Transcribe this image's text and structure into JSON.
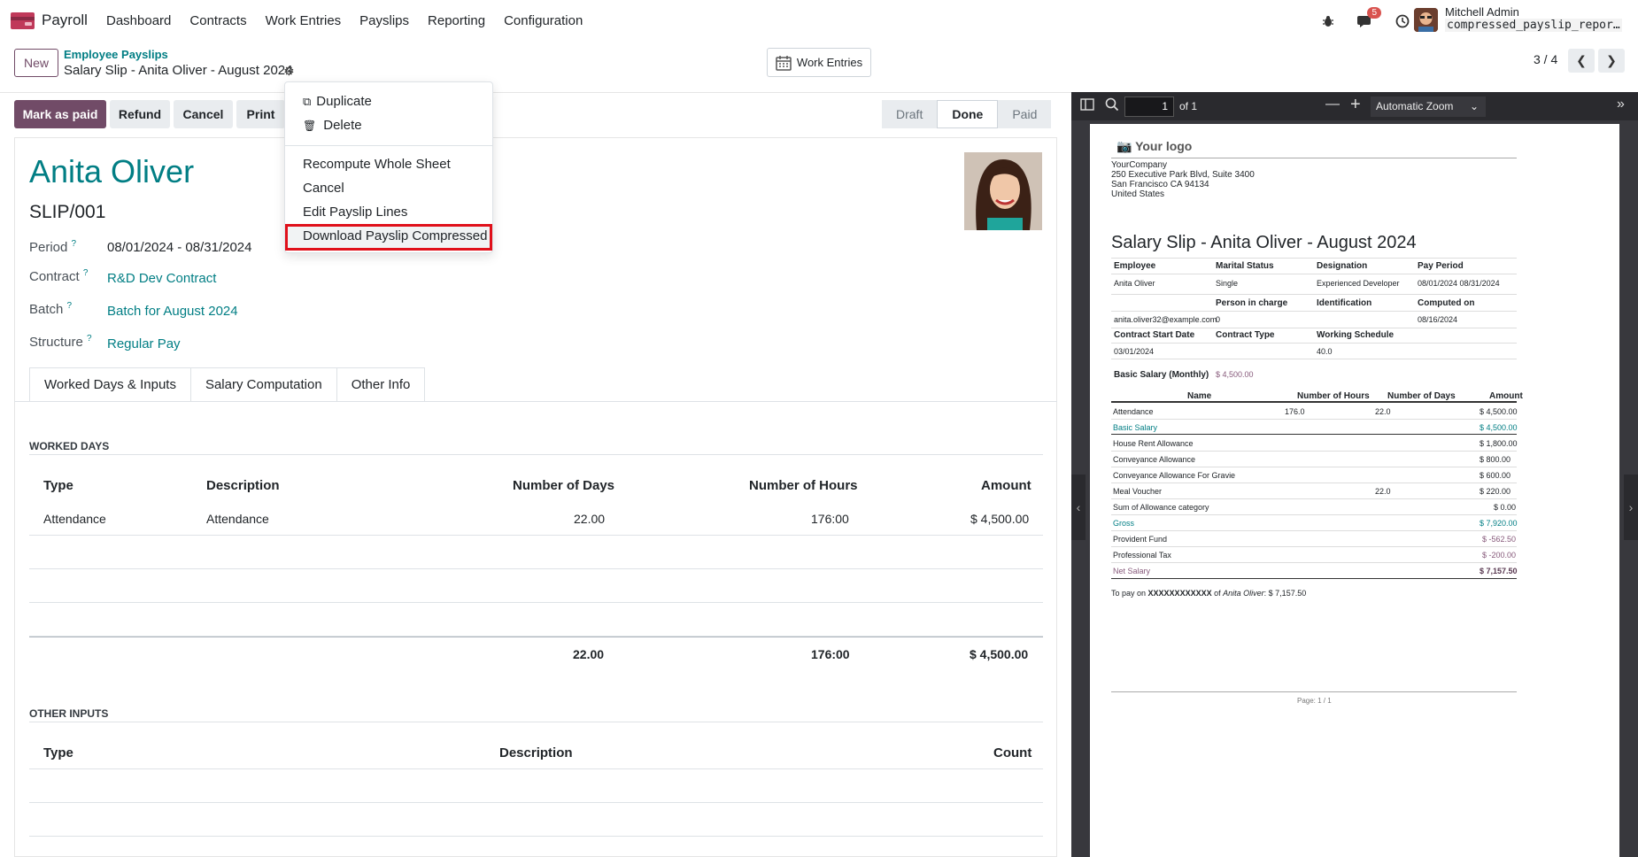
{
  "topbar": {
    "app_name": "Payroll",
    "menu": [
      "Dashboard",
      "Contracts",
      "Work Entries",
      "Payslips",
      "Reporting",
      "Configuration"
    ],
    "chat_badge": "5",
    "user_name": "Mitchell Admin",
    "db_name": "compressed_payslip_repor…"
  },
  "control": {
    "new_label": "New",
    "breadcrumb_parent": "Employee Payslips",
    "breadcrumb_current": "Salary Slip - Anita Oliver - August 2024",
    "work_entries_label": "Work Entries",
    "pager": "3 / 4"
  },
  "actions": {
    "mark_paid": "Mark as paid",
    "refund": "Refund",
    "cancel": "Cancel",
    "print": "Print",
    "status_steps": [
      "Draft",
      "Done",
      "Paid"
    ]
  },
  "dropdown": {
    "duplicate": "Duplicate",
    "delete": "Delete",
    "recompute": "Recompute Whole Sheet",
    "cancel": "Cancel",
    "edit_lines": "Edit Payslip Lines",
    "download": "Download Payslip Compressed"
  },
  "form": {
    "employee": "Anita Oliver",
    "number": "SLIP/001",
    "period_label": "Period",
    "period": "08/01/2024 - 08/31/2024",
    "contract_label": "Contract",
    "contract": "R&D Dev Contract",
    "batch_label": "Batch",
    "batch": "Batch for August 2024",
    "structure_label": "Structure",
    "structure": "Regular Pay",
    "help_mark": "?"
  },
  "tabs": [
    "Worked Days & Inputs",
    "Salary Computation",
    "Other Info"
  ],
  "worked_days": {
    "title": "WORKED DAYS",
    "headers": [
      "Type",
      "Description",
      "Number of Days",
      "Number of Hours",
      "Amount"
    ],
    "row": [
      "Attendance",
      "Attendance",
      "22.00",
      "176:00",
      "$ 4,500.00"
    ],
    "totals": [
      "22.00",
      "176:00",
      "$ 4,500.00"
    ]
  },
  "other_inputs": {
    "title": "OTHER INPUTS",
    "headers": [
      "Type",
      "Description",
      "Count"
    ]
  },
  "pdf": {
    "page": "1",
    "of": "of 1",
    "zoom": "Automatic Zoom",
    "logo": "Your logo",
    "company": [
      "YourCompany",
      "250 Executive Park Blvd, Suite 3400",
      "San Francisco CA 94134",
      "United States"
    ],
    "title": "Salary Slip - Anita Oliver - August 2024",
    "info_headers_1": [
      "Employee",
      "Marital Status",
      "Designation",
      "Pay Period"
    ],
    "info_values_1": [
      "Anita Oliver",
      "Single",
      "Experienced Developer",
      "08/01/2024 08/31/2024"
    ],
    "info_headers_2": [
      "",
      "Person in charge",
      "Identification",
      "Computed on"
    ],
    "info_values_2": [
      "anita.oliver32@example.com",
      "0",
      "",
      "08/16/2024"
    ],
    "info_headers_3": [
      "Contract Start Date",
      "Contract Type",
      "Working Schedule",
      ""
    ],
    "info_values_3": [
      "03/01/2024",
      "",
      "40.0",
      ""
    ],
    "basic_label": "Basic Salary (Monthly)",
    "basic_value": "$ 4,500.00",
    "line_headers": [
      "Name",
      "Number of Hours",
      "Number of Days",
      "Amount"
    ],
    "lines": [
      {
        "name": "Attendance",
        "hours": "176.0",
        "days": "22.0",
        "amount": "$ 4,500.00",
        "style": "normal"
      },
      {
        "name": "Basic Salary",
        "hours": "",
        "days": "",
        "amount": "$ 4,500.00",
        "style": "teal"
      },
      {
        "name": "House Rent Allowance",
        "hours": "",
        "days": "",
        "amount": "$ 1,800.00",
        "style": "normal"
      },
      {
        "name": "Conveyance Allowance",
        "hours": "",
        "days": "",
        "amount": "$ 800.00",
        "style": "normal"
      },
      {
        "name": "Conveyance Allowance For Gravie",
        "hours": "",
        "days": "",
        "amount": "$ 600.00",
        "style": "normal"
      },
      {
        "name": "Meal Voucher",
        "hours": "",
        "days": "22.0",
        "amount": "$ 220.00",
        "style": "normal"
      },
      {
        "name": "Sum of Allowance category",
        "hours": "",
        "days": "",
        "amount": "$ 0.00",
        "style": "normal"
      },
      {
        "name": "Gross",
        "hours": "",
        "days": "",
        "amount": "$ 7,920.00",
        "style": "teal"
      },
      {
        "name": "Provident Fund",
        "hours": "",
        "days": "",
        "amount": "$ -562.50",
        "style": "purple"
      },
      {
        "name": "Professional Tax",
        "hours": "",
        "days": "",
        "amount": "$ -200.00",
        "style": "purple"
      },
      {
        "name": "Net Salary",
        "hours": "",
        "days": "",
        "amount": "$ 7,157.50",
        "style": "net"
      }
    ],
    "to_pay_prefix": "To pay on",
    "to_pay_account": "XXXXXXXXXXXX",
    "to_pay_of": "of",
    "to_pay_name": "Anita Oliver",
    "to_pay_amount": ": $ 7,157.50",
    "footer": "Page: 1 / 1"
  }
}
